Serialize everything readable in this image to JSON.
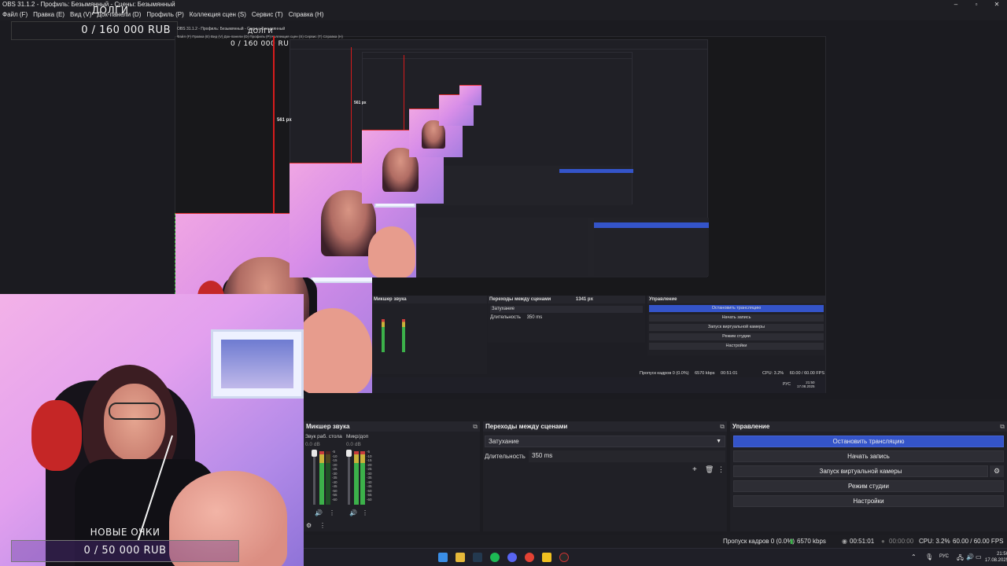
{
  "window": {
    "title": "OBS 31.1.2 - Профиль: Безымянный - Сцены: Безымянный",
    "controls": [
      "–",
      "▫",
      "✕"
    ]
  },
  "menu": [
    "Файл (F)",
    "Правка (E)",
    "Вид (V)",
    "Док-панели (D)",
    "Профиль (P)",
    "Коллекция сцен (S)",
    "Сервис (T)",
    "Справка (H)"
  ],
  "overlays": {
    "goal_top": {
      "title": "ДОЛГИ",
      "amount": "0 / 160 000 RUB"
    },
    "goal_bottom": {
      "title": "НОВЫЕ ОЧКИ",
      "amount": "0 / 50 000 RUB"
    }
  },
  "preview": {
    "measure_1": "561 px",
    "measure_2": "561 px",
    "nested_title": "OBS 31.1.2 - Профиль: Безымянный - Сцены: Безымянный",
    "nested_menu": "Файл (F)  Правка (E)  Вид (V)  Док-панели (D)  Профиль (P)  Коллекция сцен (S)  Сервис (T)  Справка (H)",
    "nested_mixer": "Микшер звука",
    "nested_transitions": "Переходы между сценами",
    "nested_size": "1341 px",
    "nested_controls": "Управление",
    "nested_fade": "Затухание",
    "nested_duration_label": "Длительность",
    "nested_duration": "350 ms",
    "nested_buttons": [
      "Остановить трансляцию",
      "Начать запись",
      "Запуск виртуальной камеры",
      "Режим студии",
      "Настройки"
    ],
    "nested_status": [
      "Пропуск кадров 0 (0.0%)",
      "6570 kbps",
      "00:51:01",
      "CPU: 3.2%",
      "60.00 / 60.00 FPS"
    ],
    "nested_tray": [
      "РУС",
      "21:50",
      "17.08.2025"
    ]
  },
  "mixer": {
    "title": "Микшер звука",
    "channels": [
      {
        "name": "Звук раб. стола",
        "db": "0.0 dB"
      },
      {
        "name": "Микр/доп",
        "db": "0.0 dB"
      }
    ],
    "scale": [
      "-5",
      "-10",
      "-15",
      "-20",
      "-25",
      "-30",
      "-35",
      "-40",
      "-45",
      "-50",
      "-55",
      "-60"
    ]
  },
  "transitions": {
    "title": "Переходы между сценами",
    "selected": "Затухание",
    "duration_label": "Длительность",
    "duration": "350 ms"
  },
  "controls": {
    "title": "Управление",
    "stop_stream": "Остановить трансляцию",
    "start_record": "Начать запись",
    "virtual_cam": "Запуск виртуальной камеры",
    "studio_mode": "Режим студии",
    "settings": "Настройки"
  },
  "status": {
    "dropped": "Пропуск кадров 0 (0.0%)",
    "bitrate": "6570 kbps",
    "stream_time": "00:51:01",
    "record_time": "00:00:00",
    "cpu": "CPU: 3.2%",
    "fps": "60.00 / 60.00 FPS"
  },
  "taskbar": {
    "lang": "РУС",
    "time": "21:50",
    "date": "17.08.2025"
  },
  "colors": {
    "accent_button": "#3454c9",
    "selection_red": "#d61c1c",
    "panel": "#202026"
  }
}
